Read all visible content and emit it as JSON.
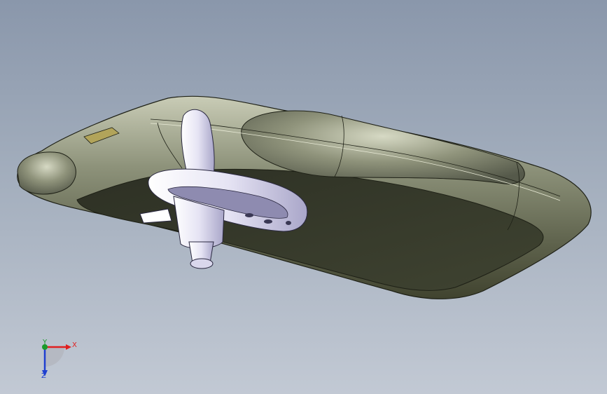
{
  "viewport": {
    "name": "3D model view",
    "background_top": "#8a97ab",
    "background_bottom": "#c2c9d4"
  },
  "model": {
    "visor_color": "#3b3f2e",
    "visor_rim_color": "#8b8f78",
    "clip_color": "#e6e4f4"
  },
  "triad": {
    "x_label": "X",
    "y_label": "Y",
    "z_label": "Z",
    "x_color": "#e02020",
    "y_color": "#1a9a2a",
    "z_color": "#1f3fd0"
  }
}
